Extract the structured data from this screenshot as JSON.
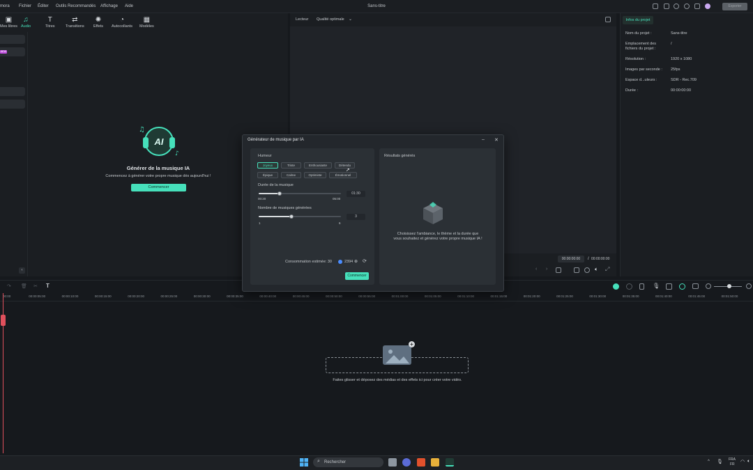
{
  "menubar": {
    "app_name_fragment": "mora",
    "items": [
      "Fichier",
      "Éditer",
      "Outils Recommandés",
      "Affichage",
      "Aide"
    ],
    "title": "Sans-titre",
    "export_label": "Exporter"
  },
  "left_panel": {
    "tabs": [
      {
        "label": "Mes libres",
        "icon": "media-icon",
        "active": false
      },
      {
        "label": "Audio",
        "icon": "music-note-icon",
        "active": true
      },
      {
        "label": "Titres",
        "icon": "text-icon",
        "active": false
      },
      {
        "label": "Transitions",
        "icon": "transition-icon",
        "active": false
      },
      {
        "label": "Effets",
        "icon": "sparkle-icon",
        "active": false
      },
      {
        "label": "Autocollants",
        "icon": "sticker-icon",
        "active": false
      },
      {
        "label": "Modèles",
        "icon": "template-icon",
        "active": false
      }
    ],
    "new_badge": "NEW",
    "ai_music": {
      "title": "Générer de la musique IA",
      "subtitle": "Commencez à générer votre propre musique dès aujourd'hui !",
      "button": "Commencer"
    }
  },
  "player": {
    "label": "Lecteur",
    "quality": "Qualité optimale",
    "time_current": "00:00:00:00",
    "time_separator": "/",
    "time_total": "00:00:00:00"
  },
  "project_info": {
    "tab": "Infos du projet",
    "rows": [
      {
        "label": "Nom du projet :",
        "value": "Sans-titre"
      },
      {
        "label": "Emplacement des fichiers du projet :",
        "value": "/"
      },
      {
        "label": "Résolution :",
        "value": "1920 x 1080"
      },
      {
        "label": "Images par seconde :",
        "value": "25fps"
      },
      {
        "label": "Espace d...uleurs :",
        "value": "SDR - Rec.709"
      },
      {
        "label": "Durée :",
        "value": "00:00:00:00"
      }
    ]
  },
  "dialog": {
    "title": "Générateur de musique par IA",
    "mood_label": "Humeur",
    "moods": [
      {
        "label": "Joyeux",
        "selected": true
      },
      {
        "label": "Triste",
        "selected": false
      },
      {
        "label": "Enthousiaste",
        "selected": false
      },
      {
        "label": "Détendu",
        "selected": false
      },
      {
        "label": "Épique",
        "selected": false
      },
      {
        "label": "Calme",
        "selected": false
      },
      {
        "label": "Optimiste",
        "selected": false
      },
      {
        "label": "Émotionnel",
        "selected": false
      }
    ],
    "duration": {
      "label": "Durée de la musique",
      "value": "01:30",
      "min": "00:20",
      "max": "05:00",
      "fraction": 0.25
    },
    "count": {
      "label": "Nombre de musiques générées",
      "value": "3",
      "min": "1",
      "max": "6",
      "fraction": 0.4
    },
    "consumption_label": "Consommation estimée: 30",
    "credits": "2394",
    "button": "Commencer",
    "results_label": "Résultats générés",
    "results_placeholder": "Choisissez l'ambiance, le thème et la durée que vous souhaitez et générez votre propre musique IA !"
  },
  "timeline": {
    "ticks": [
      "00:00",
      "00:00:05:00",
      "00:00:10:00",
      "00:00:15:00",
      "00:00:20:00",
      "00:00:25:00",
      "00:00:30:00",
      "00:00:35:00",
      "00:00:40:00",
      "00:00:45:00",
      "00:00:50:00",
      "00:00:55:00",
      "00:01:00:00",
      "00:01:05:00",
      "00:01:10:00",
      "00:01:15:00",
      "00:01:20:00",
      "00:01:25:00",
      "00:01:30:00",
      "00:01:35:00",
      "00:01:40:00",
      "00:01:45:00",
      "00:01:50:00"
    ],
    "drop_text": "Faites glisser et déposez des médias et des effets ici pour créer votre vidéo."
  },
  "taskbar": {
    "search_placeholder": "Rechercher",
    "lang_top": "FRA",
    "lang_bottom": "FR"
  },
  "colors": {
    "accent": "#46e0bb",
    "background": "#16191d",
    "panel": "#1b1e22",
    "playhead": "#e0505c",
    "badge": "#c14fe0"
  }
}
